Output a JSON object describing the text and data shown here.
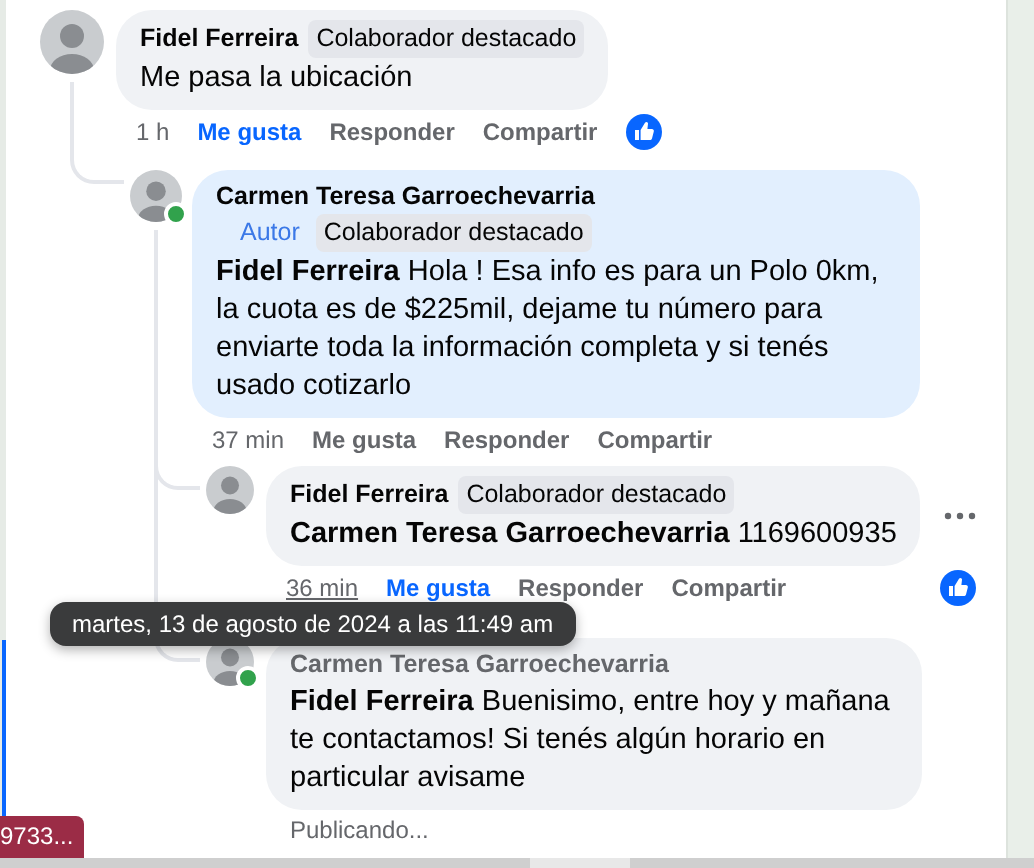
{
  "comments": [
    {
      "author": "Fidel Ferreira",
      "online": false,
      "highlighted": false,
      "pending": false,
      "badges": [
        {
          "kind": "featured",
          "label": "Colaborador destacado"
        }
      ],
      "text": "Me pasa la ubicación",
      "time": "1 h",
      "time_hovered": false,
      "liked": true,
      "reaction": true,
      "actions": [
        "Me gusta",
        "Responder",
        "Compartir"
      ],
      "children": [
        {
          "author": "Carmen Teresa Garroechevarria",
          "online": true,
          "highlighted": true,
          "pending": false,
          "badges": [
            {
              "kind": "author",
              "label": "Autor"
            },
            {
              "kind": "featured",
              "label": "Colaborador destacado"
            }
          ],
          "mention": "Fidel Ferreira",
          "text": "Hola ! Esa info es para un Polo 0km, la cuota es de $225mil, dejame tu número para enviarte toda la información completa y si tenés usado cotizarlo",
          "time": "37 min",
          "time_hovered": false,
          "liked": false,
          "actions": [
            "Me gusta",
            "Responder",
            "Compartir"
          ],
          "children": [
            {
              "author": "Fidel Ferreira",
              "online": false,
              "highlighted": false,
              "pending": false,
              "badges": [
                {
                  "kind": "featured",
                  "label": "Colaborador destacado"
                }
              ],
              "mention": "Carmen Teresa Garroechevarria",
              "text": "1169600935",
              "time": "36 min",
              "time_hovered": true,
              "liked": true,
              "reaction": true,
              "more_menu": true,
              "actions": [
                "Me gusta",
                "Responder",
                "Compartir"
              ]
            },
            {
              "author": "Carmen Teresa Garroechevarria",
              "online": true,
              "highlighted": false,
              "pending": true,
              "mention": "Fidel Ferreira",
              "text": "Buenisimo, entre hoy y mañana te contactamos! Si tenés algún horario en particular avisame",
              "status": "Publicando..."
            }
          ]
        }
      ]
    }
  ],
  "tooltip": {
    "text": "martes, 13 de agosto de 2024 a las 11:49 am"
  },
  "side_tag": "9733..."
}
